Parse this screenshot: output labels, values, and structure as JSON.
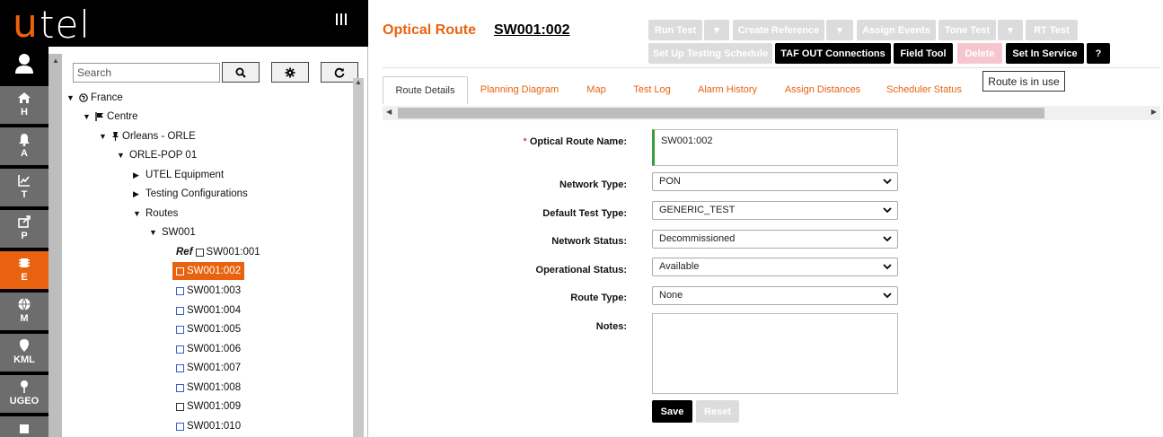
{
  "app": {
    "logo_u": "u",
    "logo_rest": "tel"
  },
  "nav": [
    {
      "label": "H",
      "icon": "home-icon"
    },
    {
      "label": "A",
      "icon": "bell-icon"
    },
    {
      "label": "T",
      "icon": "chart-icon"
    },
    {
      "label": "P",
      "icon": "share-icon"
    },
    {
      "label": "E",
      "icon": "chip-icon",
      "active": true
    },
    {
      "label": "M",
      "icon": "globe-icon"
    },
    {
      "label": "KML",
      "icon": "map-pin-icon"
    },
    {
      "label": "UGEO",
      "icon": "pin-icon"
    }
  ],
  "search": {
    "placeholder": "Search"
  },
  "tree": {
    "france": "France",
    "centre": "Centre",
    "orleans": "Orleans - ORLE",
    "orle_pop": "ORLE-POP 01",
    "utel_equipment": "UTEL Equipment",
    "testing_configurations": "Testing Configurations",
    "routes": "Routes",
    "sw001": "SW001",
    "ref_label": "Ref",
    "routes_list": [
      "SW001:001",
      "SW001:002",
      "SW001:003",
      "SW001:004",
      "SW001:005",
      "SW001:006",
      "SW001:007",
      "SW001:008",
      "SW001:009",
      "SW001:010"
    ]
  },
  "header": {
    "title": "Optical Route",
    "route_id": "SW001:002"
  },
  "toolbar": {
    "run_test": "Run Test",
    "create_reference": "Create Reference",
    "assign_events": "Assign Events",
    "tone_test": "Tone Test",
    "rt_test": "RT Test",
    "set_up_testing_schedule": "Set Up Testing Schedule",
    "taf_out_connections": "TAF OUT Connections",
    "field_tool": "Field Tool",
    "delete": "Delete",
    "set_in_service": "Set In Service",
    "help": "?",
    "tooltip": "Route is in use"
  },
  "tabs": [
    "Route Details",
    "Planning Diagram",
    "Map",
    "Test Log",
    "Alarm History",
    "Assign Distances",
    "Scheduler Status"
  ],
  "form": {
    "required_mark": "*",
    "optical_route_name_label": "Optical Route Name:",
    "optical_route_name_value": "SW001:002",
    "network_type_label": "Network Type:",
    "network_type_value": "PON",
    "default_test_type_label": "Default Test Type:",
    "default_test_type_value": "GENERIC_TEST",
    "network_status_label": "Network Status:",
    "network_status_value": "Decommissioned",
    "operational_status_label": "Operational Status:",
    "operational_status_value": "Available",
    "route_type_label": "Route Type:",
    "route_type_value": "None",
    "notes_label": "Notes:",
    "notes_value": "",
    "save": "Save",
    "reset": "Reset"
  },
  "colors": {
    "accent": "#e8620f",
    "rail": "#6d6d6d",
    "disabled": "#dcdcdc",
    "required": "#dd0000",
    "valid": "#3a9d3a"
  }
}
